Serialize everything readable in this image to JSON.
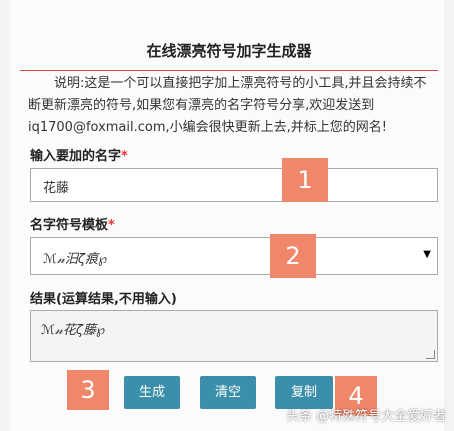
{
  "header": {
    "title": "在线漂亮符号加字生成器"
  },
  "description": {
    "line1": "　　说明:这是一个可以直接把字加上漂亮符号的小工具,并且会持续不",
    "line2": "断更新漂亮的符号,如果您有漂亮的名字符号分享,欢迎发送到",
    "line3": "iq1700@foxmail.com,小编会很快更新上去,并标上您的网名!"
  },
  "name_field": {
    "label": "输入要加的名字",
    "required_mark": "*",
    "value": "花藤"
  },
  "template_field": {
    "label": "名字符号模板",
    "required_mark": "*",
    "selected": "ℳ𝓃汨ζ痕℘",
    "caret": "▼"
  },
  "result_field": {
    "label": "结果(运算结果,不用输入)",
    "value": "ℳ𝓃花ζ藤℘"
  },
  "buttons": {
    "generate": "生成",
    "clear": "清空",
    "copy": "复制"
  },
  "annotations": {
    "b1": "1",
    "b2": "2",
    "b3": "3",
    "b4": "4"
  },
  "watermark": "头条 @特殊符号大全爱好者",
  "colors": {
    "button": "#3c8fab",
    "badge": "#f0876b",
    "required": "#ee3333",
    "title_rule": "#dd4444"
  }
}
